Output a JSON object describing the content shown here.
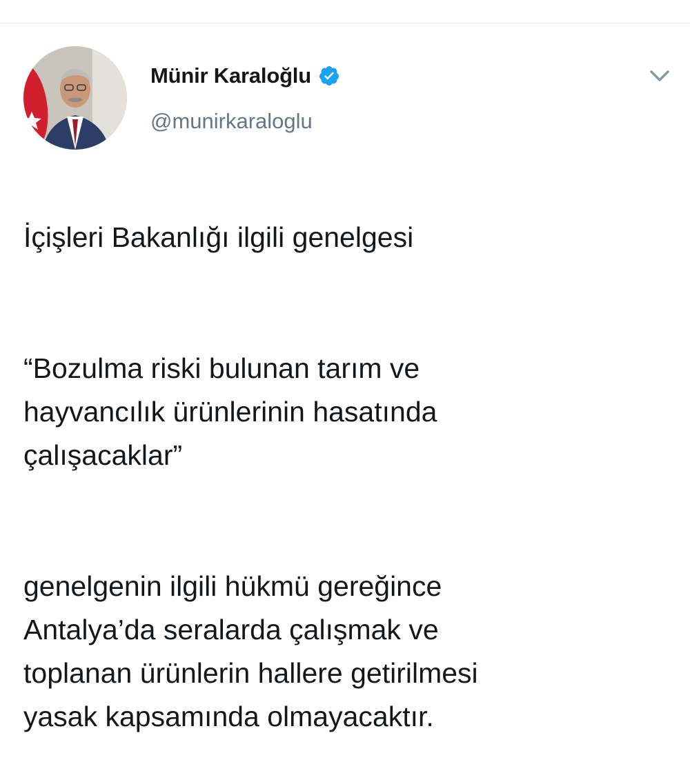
{
  "author": {
    "display_name": "Münir Karaloğlu",
    "handle": "@munirkaraloglu",
    "verified": true,
    "avatar_icon": "profile-photo",
    "verified_icon": "verified-badge-icon"
  },
  "menu": {
    "icon": "chevron-down-icon"
  },
  "tweet": {
    "paragraphs": [
      "İçişleri Bakanlığı ilgili genelgesi",
      "“Bozulma riski bulunan tarım ve\nhayvancılık ürünlerinin hasatında\nçalışacaklar”",
      "genelgenin ilgili hükmü gereğince\nAntalya’da seralarda çalışmak ve\ntoplanan ürünlerin hallere getirilmesi\nyasak kapsamında olmayacaktır."
    ]
  },
  "colors": {
    "text": "#14171a",
    "secondary_text": "#657786",
    "verified_blue": "#1da1f2",
    "divider": "#e1e8ed",
    "chevron": "#8899a6"
  }
}
